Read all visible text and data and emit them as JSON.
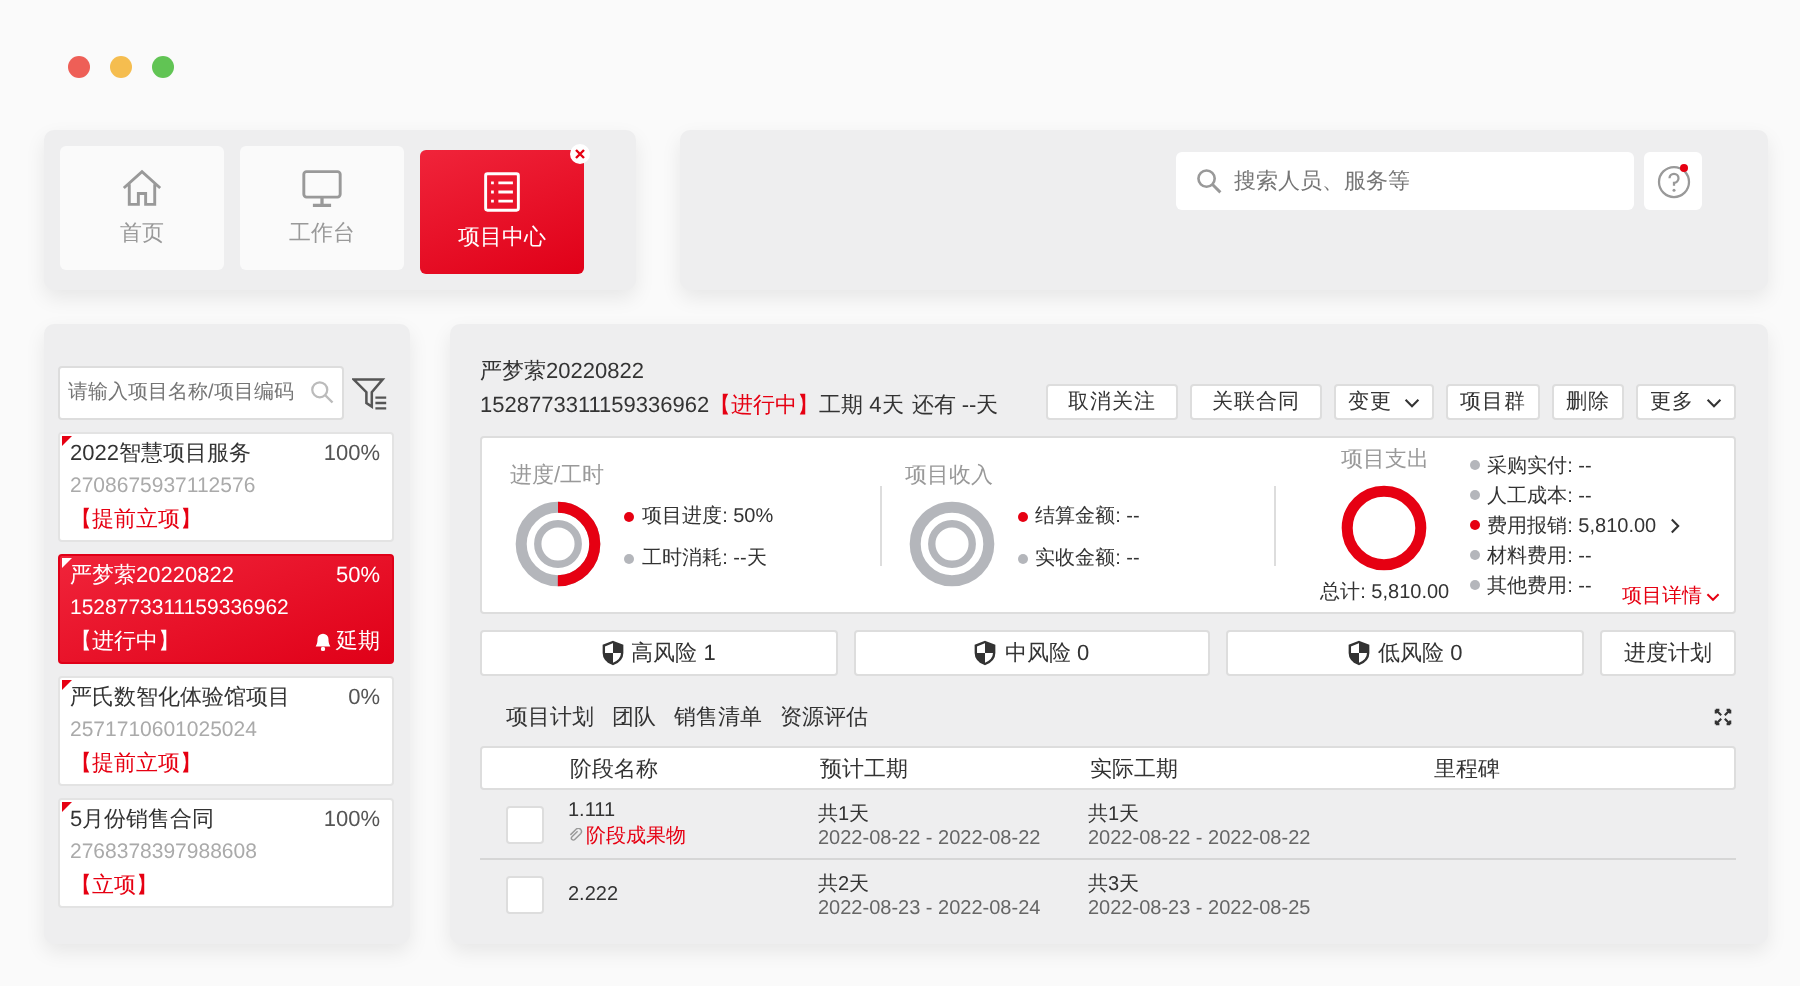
{
  "nav_tabs": [
    {
      "label": "首页",
      "selected": false,
      "closable": false
    },
    {
      "label": "工作台",
      "selected": false,
      "closable": false
    },
    {
      "label": "项目中心",
      "selected": true,
      "closable": true
    }
  ],
  "search": {
    "placeholder": "搜索人员、服务等"
  },
  "help": {
    "notification": true
  },
  "sidebar": {
    "search_placeholder": "请输入项目名称/项目编码",
    "projects": [
      {
        "name": "2022智慧项目服务",
        "percent": "100%",
        "code": "2708675937112576",
        "status": "【提前立项】",
        "selected": false
      },
      {
        "name": "严梦萦20220822",
        "percent": "50%",
        "code": "1528773311159336962",
        "status": "【进行中】",
        "selected": true,
        "badge": "延期"
      },
      {
        "name": "严氏数智化体验馆项目",
        "percent": "0%",
        "code": "2571710601025024",
        "status": "【提前立项】",
        "selected": false
      },
      {
        "name": "5月份销售合同",
        "percent": "100%",
        "code": "2768378397988608",
        "status": "【立项】",
        "selected": false
      }
    ]
  },
  "project": {
    "name": "严梦萦20220822",
    "code": "1528773311159336962",
    "status": "【进行中】",
    "duration": "工期 4天",
    "remaining": "还有 --天",
    "actions": [
      {
        "label": "取消关注",
        "kind": "button"
      },
      {
        "label": "关联合同",
        "kind": "button"
      },
      {
        "label": "变更",
        "kind": "dropdown"
      },
      {
        "label": "项目群",
        "kind": "button"
      },
      {
        "label": "删除",
        "kind": "button"
      },
      {
        "label": "更多",
        "kind": "dropdown"
      }
    ]
  },
  "summary": [
    {
      "title": "进度/工时",
      "kind": "progress",
      "level": 0.5,
      "items": [
        {
          "label": "项目进度: 50%",
          "color": "#e60012"
        },
        {
          "label": "工时消耗: --天",
          "color": "#b4b6bb"
        }
      ]
    },
    {
      "title": "项目收入",
      "kind": "income",
      "items": [
        {
          "label": "结算金额: --",
          "color": "#e60012"
        },
        {
          "label": "实收金额: --",
          "color": "#b4b6bb"
        }
      ]
    },
    {
      "title": "项目支出",
      "kind": "expense",
      "total": "总计: 5,810.00",
      "items": [
        {
          "label": "采购实付: --",
          "color": "#b4b6bb"
        },
        {
          "label": "人工成本: --",
          "color": "#b4b6bb"
        },
        {
          "label": "费用报销: 5,810.00",
          "color": "#e60012",
          "more": true
        },
        {
          "label": "材料费用: --",
          "color": "#b4b6bb"
        },
        {
          "label": "其他费用: --",
          "color": "#b4b6bb"
        }
      ],
      "details_link": "项目详情"
    }
  ],
  "risks": [
    {
      "label": "高风险 1"
    },
    {
      "label": "中风险 0"
    },
    {
      "label": "低风险 0"
    }
  ],
  "schedule_button": "进度计划",
  "sub_tabs": [
    "项目计划",
    "团队",
    "销售清单",
    "资源评估"
  ],
  "table": {
    "columns": [
      "阶段名称",
      "预计工期",
      "实际工期",
      "里程碑"
    ],
    "rows": [
      {
        "checked": false,
        "name": "1.111",
        "deliverable": "阶段成果物",
        "planned_days": "共1天",
        "planned_range": "2022-08-22 - 2022-08-22",
        "actual_days": "共1天",
        "actual_range": "2022-08-22 - 2022-08-22"
      },
      {
        "checked": false,
        "name": "2.222",
        "planned_days": "共2天",
        "planned_range": "2022-08-23 - 2022-08-24",
        "actual_days": "共3天",
        "actual_range": "2022-08-23 - 2022-08-25"
      }
    ]
  }
}
